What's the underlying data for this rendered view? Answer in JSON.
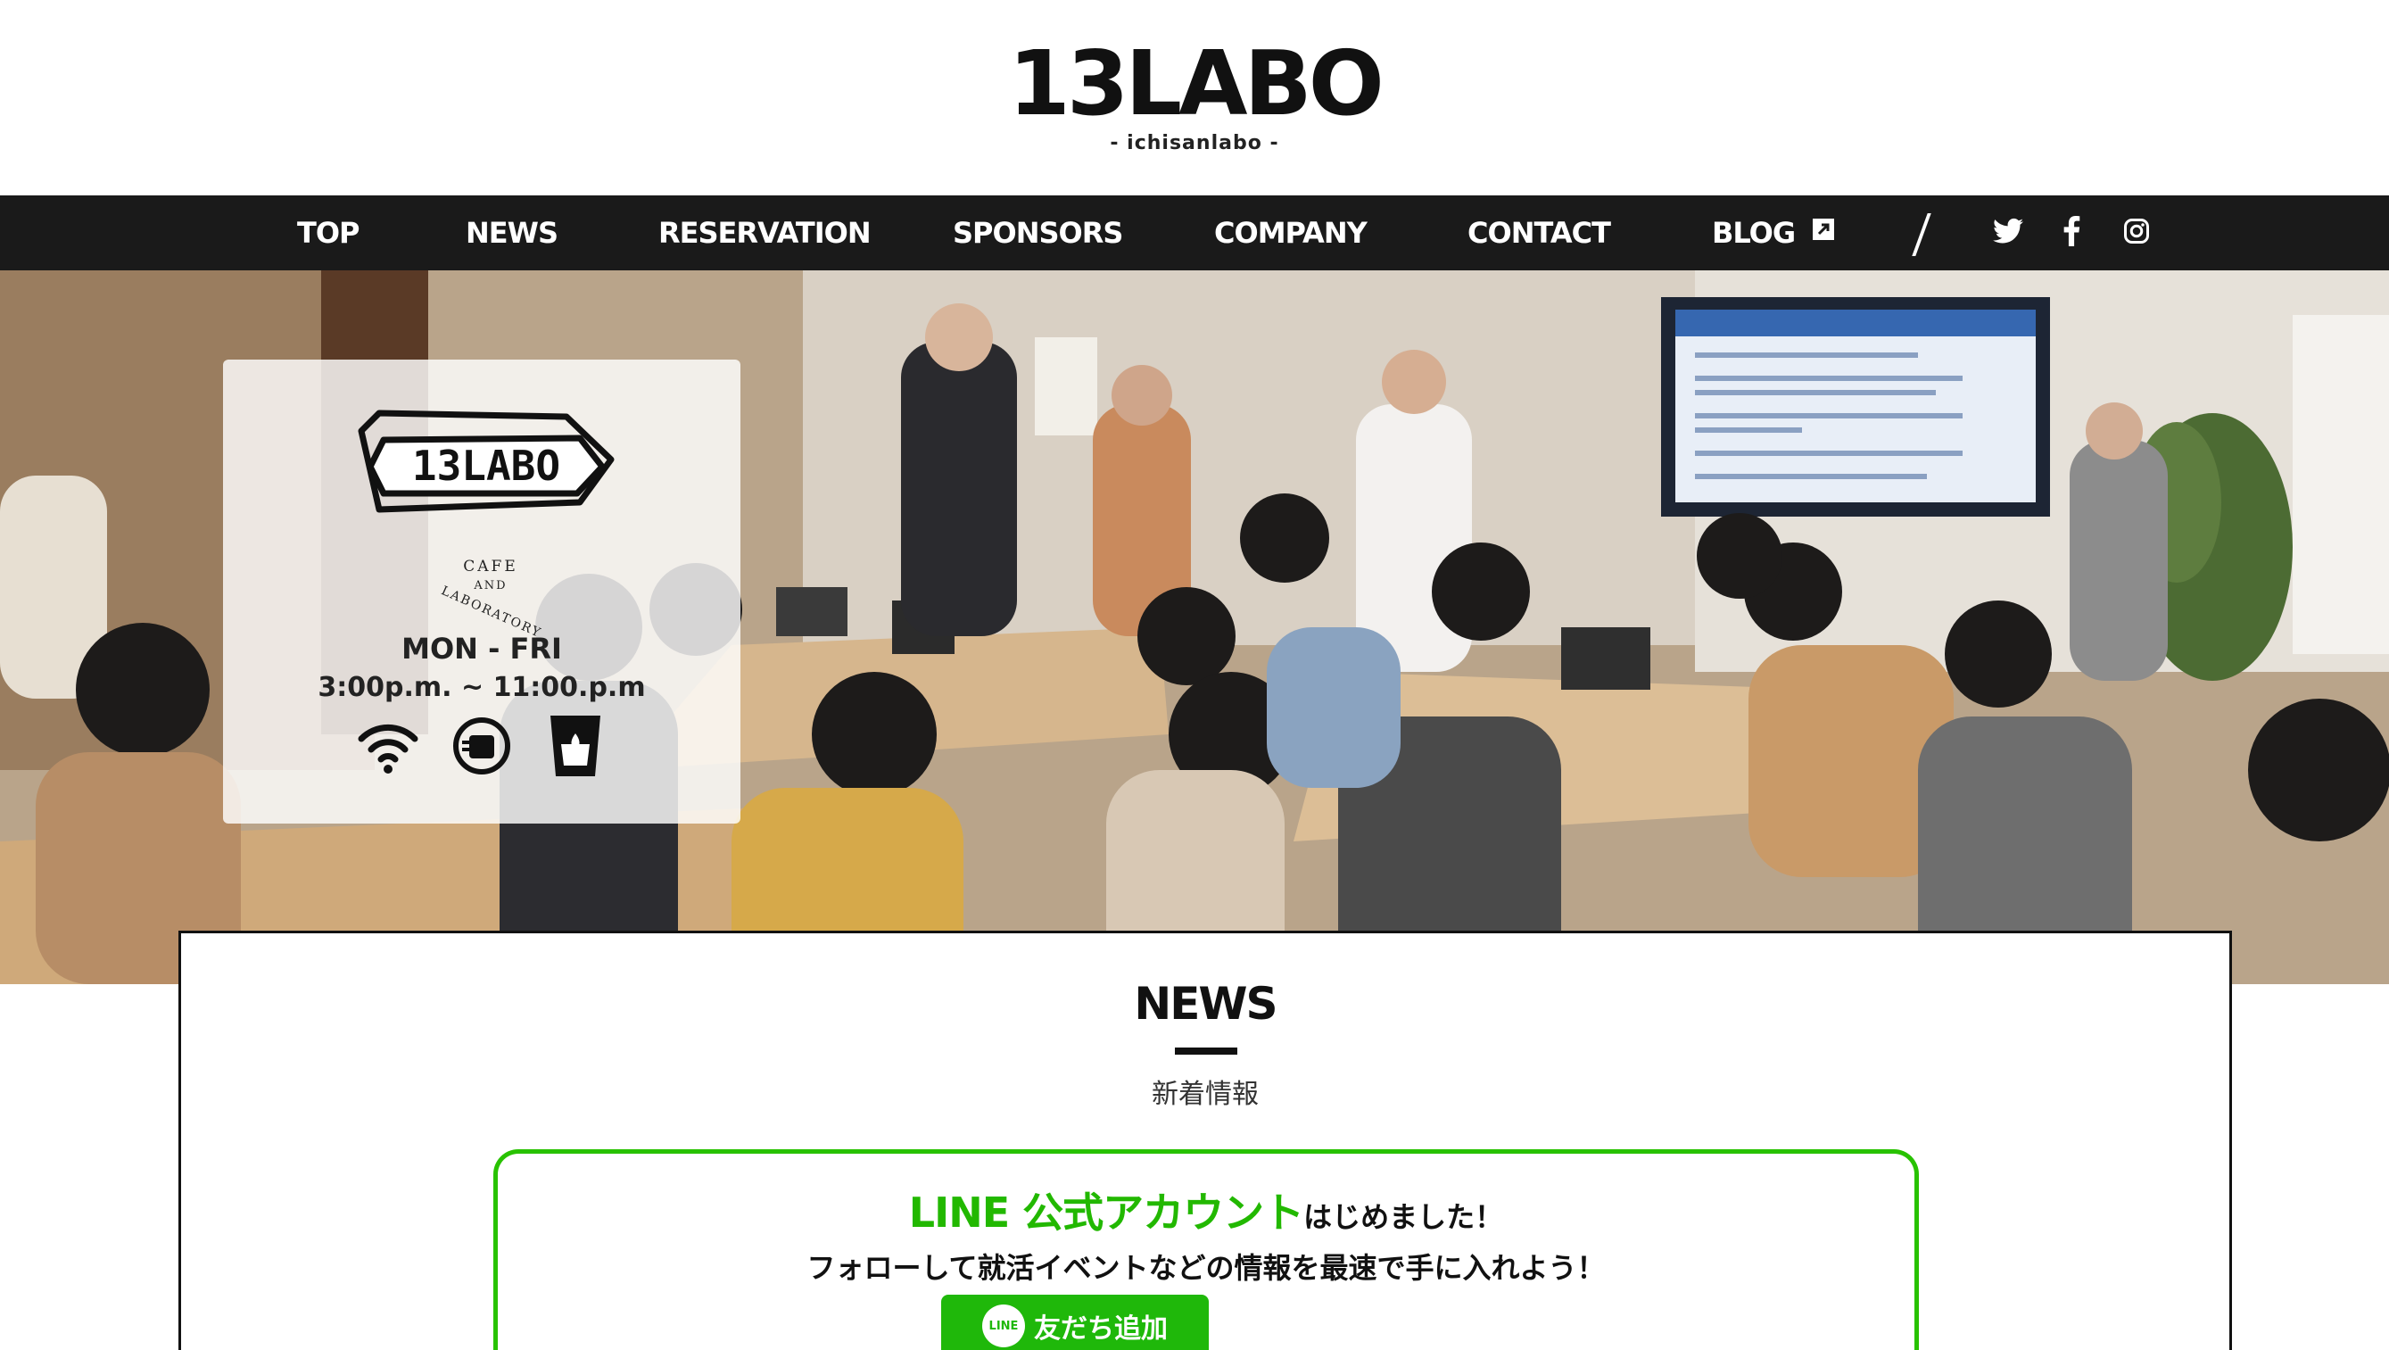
{
  "brand": {
    "name": "13LABO",
    "tagline": "- ichisanlabo -"
  },
  "nav": {
    "items": [
      {
        "label": "TOP"
      },
      {
        "label": "NEWS"
      },
      {
        "label": "RESERVATION"
      },
      {
        "label": "SPONSORS"
      },
      {
        "label": "COMPANY"
      },
      {
        "label": "CONTACT"
      },
      {
        "label": "BLOG",
        "icon": "external-link-icon"
      }
    ],
    "social": [
      "twitter-icon",
      "facebook-icon",
      "instagram-icon"
    ]
  },
  "hero": {
    "card": {
      "logo_text": "13LABO",
      "cafe_lines": [
        "CAFE",
        "AND",
        "LABORATORY"
      ],
      "days": "MON - FRI",
      "hours": "3:00p.m. ~ 11:00.p.m",
      "amenity_icons": [
        "wifi-icon",
        "drink-icon",
        "cup-icon"
      ]
    }
  },
  "news": {
    "title": "NEWS",
    "subtitle": "新着情報",
    "line_promo": {
      "accent": "LINE 公式アカウント",
      "heading_rest": "はじめました！",
      "description": "フォローして就活イベントなどの情報を最速で手に入れよう！",
      "badge": "LINE",
      "button_label": "友だち追加"
    }
  },
  "colors": {
    "nav_bg": "#1a1a1a",
    "line_green": "#22b800",
    "text": "#111111"
  }
}
